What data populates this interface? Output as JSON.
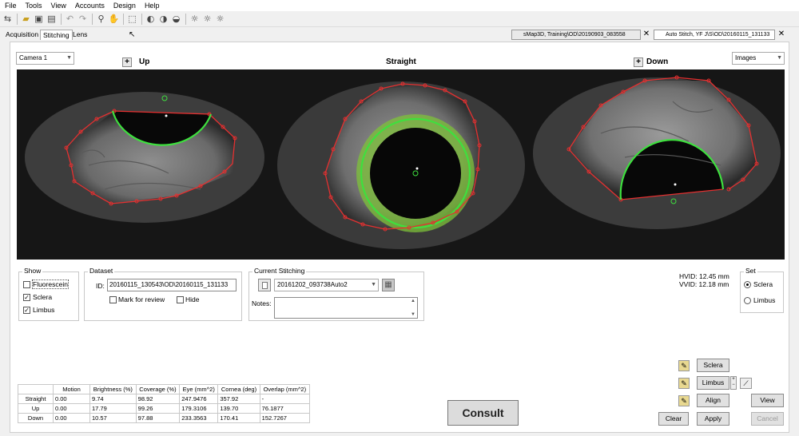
{
  "menu": [
    "File",
    "Tools",
    "View",
    "Accounts",
    "Design",
    "Help"
  ],
  "tabs": [
    "Acquisition",
    "Stitching",
    "Lens"
  ],
  "doc_tabs": [
    {
      "label": "sMap3D, Training\\OD\\20190903_083558"
    },
    {
      "label": "Auto Stitch, YF J\\S\\OD\\20160115_131133"
    }
  ],
  "camera_select": "Camera 1",
  "images_select": "Images",
  "views": {
    "up": "Up",
    "straight": "Straight",
    "down": "Down"
  },
  "show": {
    "title": "Show",
    "fluorescein": "Fluorescein",
    "sclera": "Sclera",
    "limbus": "Limbus"
  },
  "dataset": {
    "title": "Dataset",
    "id_label": "ID:",
    "id_value": "20160115_130543\\OD\\20160115_131133",
    "mark_review": "Mark for review",
    "hide": "Hide"
  },
  "current_stitching": {
    "title": "Current Stitching",
    "value": "20161202_093738Auto2",
    "notes_label": "Notes:"
  },
  "measurements": {
    "hvid": "HVID: 12.45 mm",
    "vvid": "VVID: 12.18 mm"
  },
  "set": {
    "title": "Set",
    "sclera": "Sclera",
    "limbus": "Limbus"
  },
  "stats_table": {
    "headers": [
      "",
      "Motion",
      "Brightness (%)",
      "Coverage (%)",
      "Eye (mm^2)",
      "Cornea (deg)",
      "Overlap (mm^2)"
    ],
    "rows": [
      [
        "Straight",
        "0.00",
        "9.74",
        "98.92",
        "247.9476",
        "357.92",
        "-"
      ],
      [
        "Up",
        "0.00",
        "17.79",
        "99.26",
        "179.3106",
        "139.70",
        "76.1877"
      ],
      [
        "Down",
        "0.00",
        "10.57",
        "97.88",
        "233.3563",
        "170.41",
        "152.7267"
      ]
    ]
  },
  "buttons": {
    "consult": "Consult",
    "sclera": "Sclera",
    "limbus": "Limbus",
    "align": "Align",
    "view": "View",
    "clear": "Clear",
    "apply": "Apply",
    "cancel": "Cancel"
  },
  "colors": {
    "contour": "#e53030",
    "limbus": "#3ee03e",
    "limbus_ring": "#7dc23a"
  }
}
